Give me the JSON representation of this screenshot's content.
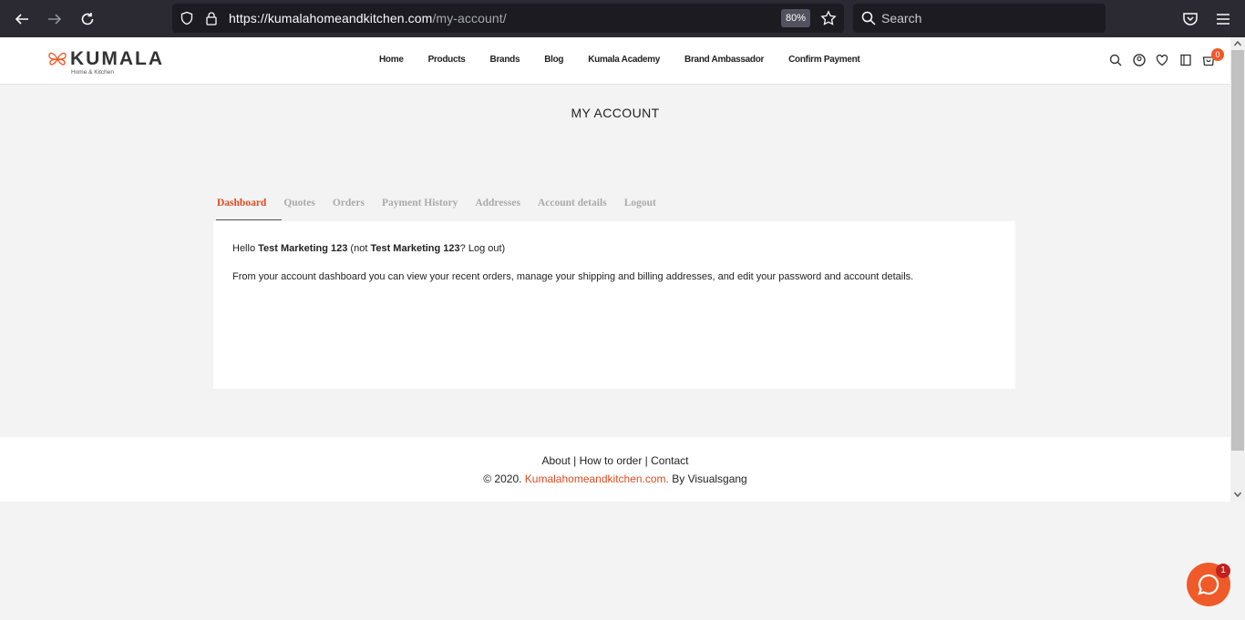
{
  "browser": {
    "url_host": "https://kumalahomeandkitchen.com",
    "url_path": "/my-account/",
    "zoom": "80%",
    "search_placeholder": "Search"
  },
  "logo": {
    "name": "KUMALA",
    "tagline": "Home & Kitchen"
  },
  "nav": {
    "items": [
      "Home",
      "Products",
      "Brands",
      "Blog",
      "Kumala Academy",
      "Brand Ambassador",
      "Confirm Payment"
    ]
  },
  "header": {
    "cart_count": "0"
  },
  "page": {
    "title": "MY ACCOUNT"
  },
  "tabs": [
    "Dashboard",
    "Quotes",
    "Orders",
    "Payment History",
    "Addresses",
    "Account details",
    "Logout"
  ],
  "dashboard": {
    "hello_prefix": "Hello ",
    "username": "Test Marketing 123",
    "not_prefix": " (not ",
    "username_2": "Test Marketing 123",
    "logout_link": "? Log out)",
    "description": "From your account dashboard you can view your recent orders, manage your shipping and billing addresses, and edit your password and account details."
  },
  "footer": {
    "about": "About",
    "how_to_order": "How to order",
    "contact": "Contact",
    "sep": " | ",
    "copy_prefix": "© 2020. ",
    "brand": "Kumalahomeandkitchen.com.",
    "copy_suffix": " By Visualsgang"
  },
  "chat": {
    "badge": "1"
  },
  "colors": {
    "accent": "#e04b1e",
    "cart_badge": "#f05a28"
  }
}
